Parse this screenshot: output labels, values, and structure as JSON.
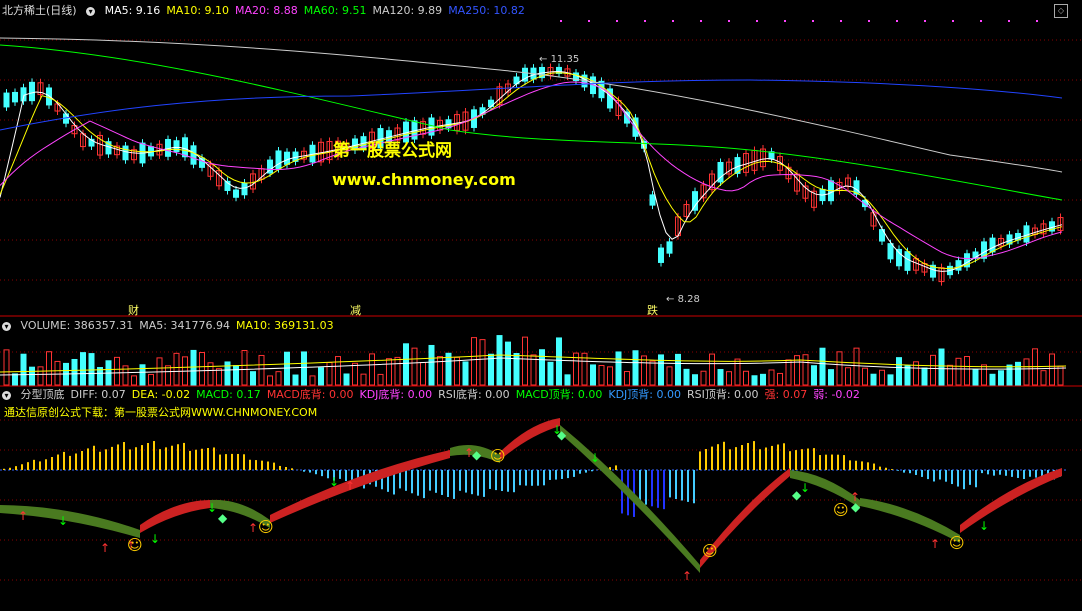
{
  "main_panel": {
    "title": "北方稀土(日线)",
    "indicators": [
      {
        "label": "MA5: 9.16",
        "color": "#ffffff"
      },
      {
        "label": "MA10: 9.10",
        "color": "#ffff00"
      },
      {
        "label": "MA20: 8.88",
        "color": "#ff44ff"
      },
      {
        "label": "MA60: 9.51",
        "color": "#00ff00"
      },
      {
        "label": "MA120: 9.89",
        "color": "#cccccc"
      },
      {
        "label": "MA250: 10.82",
        "color": "#3355ff"
      }
    ],
    "watermark_cn": "第一股票公式网",
    "watermark_url": "www.chnmoney.com",
    "high_label": "11.35",
    "low_label": "8.28",
    "event_tags": [
      "财",
      "减",
      "跌"
    ]
  },
  "volume_panel": {
    "indicators": [
      {
        "label": "VOLUME: 386357.31",
        "color": "#cccccc"
      },
      {
        "label": "MA5: 341776.94",
        "color": "#cccccc"
      },
      {
        "label": "MA10: 369131.03",
        "color": "#ffff00"
      }
    ]
  },
  "macd_panel": {
    "indicators": [
      {
        "label": "分型顶底",
        "color": "#cccccc"
      },
      {
        "label": "DIFF: 0.07",
        "color": "#cccccc"
      },
      {
        "label": "DEA: -0.02",
        "color": "#ffff00"
      },
      {
        "label": "MACD: 0.17",
        "color": "#00ff00"
      },
      {
        "label": "MACD底背: 0.00",
        "color": "#ff3333"
      },
      {
        "label": "KDJ底背: 0.00",
        "color": "#ff44ff"
      },
      {
        "label": "RSI底背: 0.00",
        "color": "#cccccc"
      },
      {
        "label": "MACD顶背: 0.00",
        "color": "#00ff00"
      },
      {
        "label": "KDJ顶背: 0.00",
        "color": "#3399ff"
      },
      {
        "label": "RSI顶背: 0.00",
        "color": "#cccccc"
      },
      {
        "label": "强: 0.07",
        "color": "#ff3333"
      },
      {
        "label": "弱: -0.02",
        "color": "#ff44ff"
      }
    ],
    "subtitle": "通达信原创公式下载：第一股票公式网WWW.CHNMONEY.COM"
  },
  "colors": {
    "up": "#ff3333",
    "down": "#44ffff",
    "grid": "#8b0000"
  },
  "icons": [
    "circle-menu-icon",
    "expand-icon",
    "smiley-icon",
    "diamond-icon",
    "arrow-up-icon",
    "arrow-down-icon"
  ]
}
